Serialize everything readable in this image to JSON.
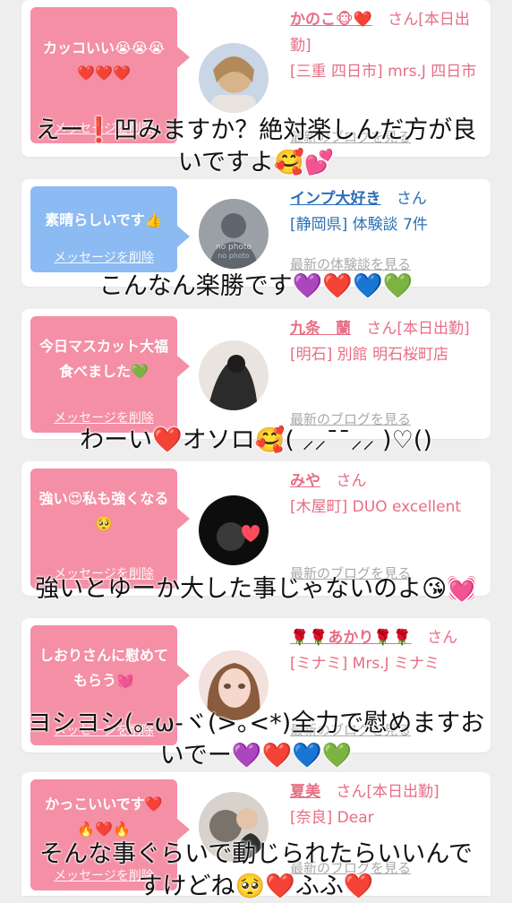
{
  "cards": [
    {
      "bubble_text": "カッコいい😭😭😭❤️❤️❤️",
      "delete_link": "メッセージを削除",
      "name": "かのこ🐵❤️",
      "san": "さん",
      "status": "[本日出勤]",
      "area": "[三重 四日市] mrs.J 四日市",
      "latest": "最新のブログを見る"
    },
    {
      "bubble_text": "素晴らしいです👍",
      "delete_link": "メッセージを削除",
      "name": "インプ大好き",
      "san": "さん",
      "status": "",
      "area": "[静岡県] 体験談 7件",
      "latest": "最新の体験談を見る",
      "avatar_label_1": "no photo",
      "avatar_label_2": "no photo"
    },
    {
      "bubble_text": "今日マスカット大福食べました💚",
      "delete_link": "メッセージを削除",
      "name": "九条　蘭",
      "san": "さん",
      "status": "[本日出勤]",
      "area": "[明石] 別館 明石桜町店",
      "latest": "最新のブログを見る"
    },
    {
      "bubble_text": "強い😍私も強くなる🥺",
      "delete_link": "メッセージを削除",
      "name": "みや",
      "san": "さん",
      "status": "",
      "area": "[木屋町] DUO excellent",
      "latest": "最新のブログを見る"
    },
    {
      "bubble_text": "しおりさんに慰めてもらう💓",
      "delete_link": "メッセージを削除",
      "name": "🌹🌹あかり🌹🌹",
      "san": "さん",
      "status": "",
      "area": "[ミナミ] Mrs.J ミナミ",
      "latest": "最新のブログを見る"
    },
    {
      "bubble_text": "かっこいいです❤️🔥❤️🔥",
      "delete_link": "メッセージを削除",
      "name": "夏美",
      "san": "さん",
      "status": "[本日出勤]",
      "area": "[奈良] Dear",
      "latest": "最新のブログを見る"
    }
  ],
  "overlays": [
    {
      "line1": "えー❗️凹みますか？絶対楽しんだ方が良",
      "line2": "いですよ🥰💕"
    },
    {
      "line1": "こんなん楽勝です💜❤️💙💚",
      "line2": ""
    },
    {
      "line1": "わーい❤️オソロ🥰( ⸝⸝¯¯⸝⸝ )♡()",
      "line2": ""
    },
    {
      "line1": "強いとゆーか大した事じゃないのよ😘💓",
      "line2": ""
    },
    {
      "line1": "ヨシヨシ(｡-ω-ヾ(>｡<*)全力で慰めますお",
      "line2": "いでー💜❤️💙💚"
    },
    {
      "line1": "そんな事ぐらいで動じられたらいいんで",
      "line2": "すけどね🥺❤️ふふ❤️"
    }
  ],
  "colors": {
    "pink": "#f48fa5",
    "blue": "#8cbaf2",
    "name_pink": "#e86d85",
    "name_blue": "#2d6fb6",
    "muted": "#a9a9a9"
  }
}
